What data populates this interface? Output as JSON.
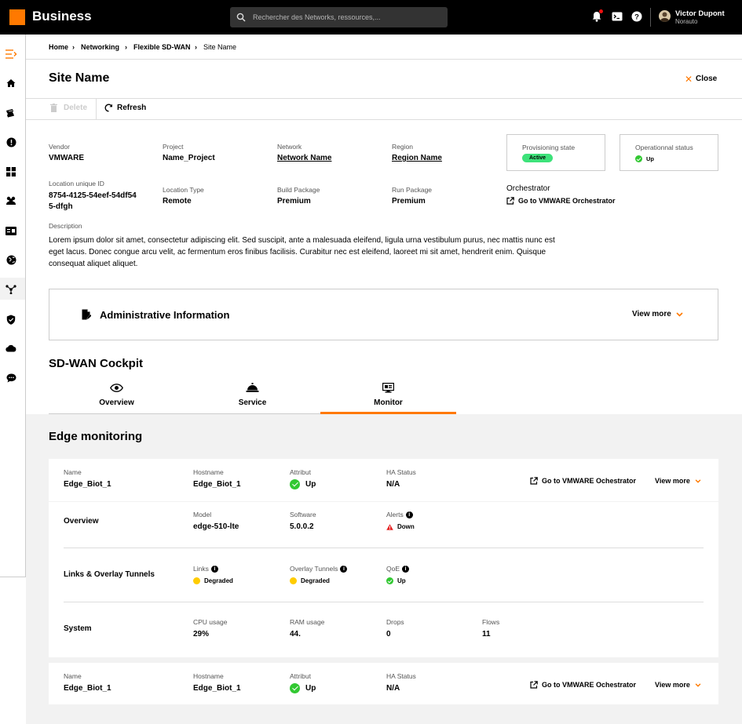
{
  "topbar": {
    "brand": "Business",
    "search_placeholder": "Rechercher des Networks, ressources,...",
    "user_name": "Victor Dupont",
    "user_org": "Norauto"
  },
  "breadcrumb": [
    "Home",
    "Networking",
    "Flexible SD-WAN",
    "Site Name"
  ],
  "page": {
    "title": "Site Name",
    "close_label": "Close"
  },
  "toolbar": {
    "delete_label": "Delete",
    "refresh_label": "Refresh"
  },
  "details": {
    "vendor": {
      "label": "Vendor",
      "value": "VMWARE"
    },
    "project": {
      "label": "Project",
      "value": "Name_Project"
    },
    "network": {
      "label": "Network",
      "value": "Network Name"
    },
    "region": {
      "label": "Region",
      "value": "Region Name"
    },
    "location_id": {
      "label": "Location unique ID",
      "value_line1": "8754-4125-54eef-54df54",
      "value_line2": "5-dfgh"
    },
    "location_type": {
      "label": "Location Type",
      "value": "Remote"
    },
    "build_package": {
      "label": "Build Package",
      "value": "Premium"
    },
    "run_package": {
      "label": "Run Package",
      "value": "Premium"
    },
    "orchestrator": {
      "label": "Orchestrator",
      "link": "Go to VMWARE Orchestrator"
    },
    "provisioning": {
      "label": "Provisioning state",
      "value": "Active"
    },
    "operational": {
      "label": "Operationnal status",
      "value": "Up"
    },
    "description": {
      "label": "Description",
      "text": "Lorem ipsum dolor sit amet, consectetur adipiscing elit. Sed suscipit, ante a malesuada eleifend, ligula urna vestibulum purus, nec mattis nunc est eget lacus. Donec congue arcu velit, ac fermentum eros finibus facilisis. Curabitur nec est eleifend, laoreet mi sit amet, hendrerit enim. Quisque consequat aliquet aliquet."
    }
  },
  "admin": {
    "title": "Administrative Information",
    "view_more": "View more"
  },
  "cockpit": {
    "title": "SD-WAN Cockpit",
    "tabs": [
      {
        "label": "Overview",
        "icon": "eye-icon"
      },
      {
        "label": "Service",
        "icon": "service-bell-icon"
      },
      {
        "label": "Monitor",
        "icon": "monitor-icon"
      }
    ],
    "active_tab": "Monitor"
  },
  "edge_monitoring": {
    "title": "Edge monitoring",
    "labels": {
      "name": "Name",
      "hostname": "Hostname",
      "attribut": "Attribut",
      "ha_status": "HA Status",
      "model": "Model",
      "software": "Software",
      "alerts": "Alerts",
      "links": "Links",
      "overlay_tunnels": "Overlay Tunnels",
      "qoe": "QoE",
      "cpu": "CPU usage",
      "ram": "RAM usage",
      "drops": "Drops",
      "flows": "Flows"
    },
    "orchestrator_link": "Go to VMWARE Ochestrator",
    "view_more": "View more",
    "edges": [
      {
        "name": "Edge_Biot_1",
        "hostname": "Edge_Biot_1",
        "attribut": "Up",
        "ha_status": "N/A",
        "overview": {
          "title": "Overview",
          "model": "edge-510-lte",
          "software": "5.0.0.2",
          "alerts": "Down"
        },
        "links_section": {
          "title": "Links & Overlay Tunnels",
          "links": "Degraded",
          "overlay_tunnels": "Degraded",
          "qoe": "Up"
        },
        "system": {
          "title": "System",
          "cpu": "29%",
          "ram": "44.",
          "drops": "0",
          "flows": "11"
        }
      },
      {
        "name": "Edge_Biot_1",
        "hostname": "Edge_Biot_1",
        "attribut": "Up",
        "ha_status": "N/A"
      }
    ]
  },
  "colors": {
    "accent": "#ff7900",
    "active_pill": "#3de27a",
    "status_up": "#32c832",
    "status_degraded": "#ffcc00",
    "status_down": "#e52222"
  }
}
